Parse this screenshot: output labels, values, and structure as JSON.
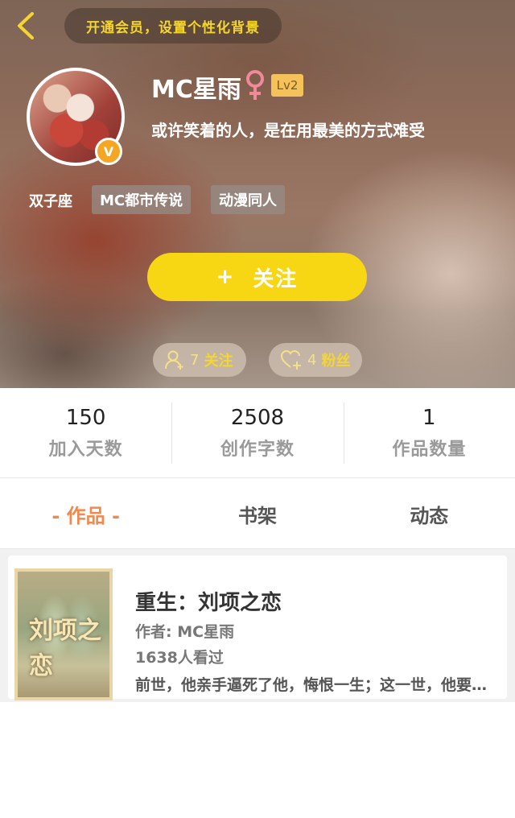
{
  "header": {
    "vip_banner": "开通会员，设置个性化背景",
    "username": "MC星雨",
    "gender_symbol": "♀",
    "level": "Lv2",
    "avatar_badge": "V",
    "signature": "或许笑着的人，是在用最美的方式难受",
    "zodiac": "双子座",
    "tags": [
      "MC都市传说",
      "动漫同人"
    ],
    "follow_button": {
      "icon": "+",
      "label": "关注"
    },
    "following": {
      "count": "7",
      "label": "关注"
    },
    "fans": {
      "count": "4",
      "label": "粉丝"
    }
  },
  "stats": [
    {
      "value": "150",
      "label": "加入天数"
    },
    {
      "value": "2508",
      "label": "创作字数"
    },
    {
      "value": "1",
      "label": "作品数量"
    }
  ],
  "tabs": [
    {
      "label": "- 作品 -",
      "active": true
    },
    {
      "label": "书架",
      "active": false
    },
    {
      "label": "动态",
      "active": false
    }
  ],
  "works": [
    {
      "title": "重生：刘项之恋",
      "author": "作者: MC星雨",
      "views": "1638人看过",
      "description": "前世，他亲手逼死了他，悔恨一生；这一世，他要用尽全力去守护他……",
      "cover_text": "刘项之恋"
    }
  ],
  "colors": {
    "accent_yellow": "#f7d714",
    "banner_text": "#f5d530",
    "active_tab": "#f0894f",
    "level_badge": "#f5c15a"
  },
  "icons": {
    "back": "chevron-left-icon",
    "gender": "female-icon",
    "following": "user-plus-icon",
    "fans": "heart-plus-icon"
  }
}
